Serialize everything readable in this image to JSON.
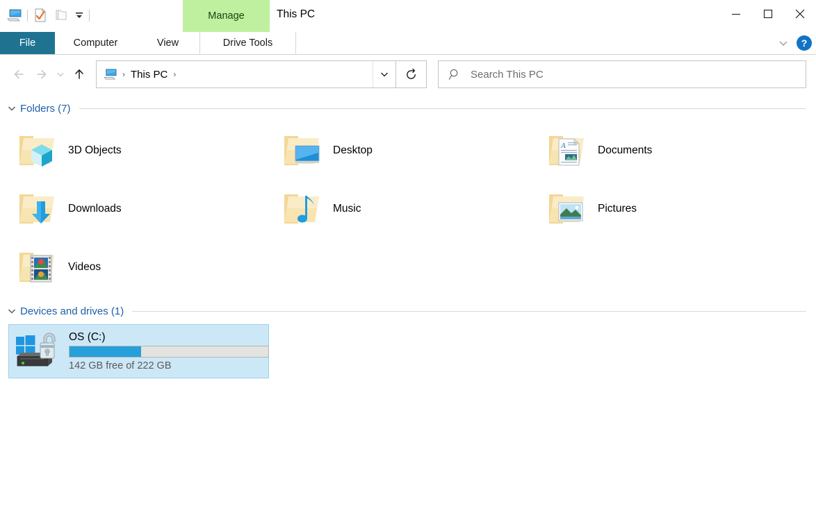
{
  "window": {
    "title": "This PC",
    "quick_access": [
      {
        "name": "this-pc-icon",
        "label": "This PC"
      },
      {
        "name": "properties-icon",
        "label": "Properties"
      },
      {
        "name": "new-folder-icon",
        "label": "New folder"
      },
      {
        "name": "customize-quick-access-icon",
        "label": "Customize Quick Access Toolbar"
      }
    ],
    "controls": {
      "minimize": "—",
      "maximize": "□",
      "close": "✕"
    }
  },
  "ribbon": {
    "contextual_group": "Manage",
    "tabs": [
      {
        "label": "File",
        "id": "file"
      },
      {
        "label": "Computer",
        "id": "computer"
      },
      {
        "label": "View",
        "id": "view"
      },
      {
        "label": "Drive Tools",
        "id": "drive-tools"
      }
    ],
    "collapse_icon": "chevron-down-icon",
    "help_label": "?"
  },
  "navigation": {
    "back_label": "Back",
    "forward_label": "Forward",
    "recent_label": "Recent locations",
    "up_label": "Up",
    "breadcrumb": {
      "icon": "this-pc-icon",
      "items": [
        "This PC"
      ],
      "separator": "›"
    },
    "address_dropdown": "chevron-down-icon",
    "refresh_label": "Refresh"
  },
  "search": {
    "placeholder": "Search This PC",
    "value": "",
    "icon": "search-icon"
  },
  "groups": [
    {
      "id": "folders",
      "title": "Folders (7)",
      "chevron": "chevron-down-icon",
      "items": [
        {
          "label": "3D Objects",
          "icon": "folder-3d-objects-icon"
        },
        {
          "label": "Desktop",
          "icon": "folder-desktop-icon"
        },
        {
          "label": "Documents",
          "icon": "folder-documents-icon"
        },
        {
          "label": "Downloads",
          "icon": "folder-downloads-icon"
        },
        {
          "label": "Music",
          "icon": "folder-music-icon"
        },
        {
          "label": "Pictures",
          "icon": "folder-pictures-icon"
        },
        {
          "label": "Videos",
          "icon": "folder-videos-icon"
        }
      ]
    },
    {
      "id": "devices",
      "title": "Devices and drives (1)",
      "chevron": "chevron-down-icon",
      "drives": [
        {
          "name": "OS (C:)",
          "capacity_text": "142 GB free of 222 GB",
          "free_gb": 142,
          "total_gb": 222,
          "used_percent": 36,
          "selected": true,
          "icon": "windows-drive-bitlocker-icon"
        }
      ]
    }
  ],
  "colors": {
    "file_tab": "#1f7391",
    "contextual_group": "#bff0a0",
    "group_title": "#1d5fa8",
    "selection": "#cce8f7",
    "selection_border": "#99d1f0",
    "drive_bar_fill": "#26a0da",
    "drive_bar_track": "#e3e3e1",
    "help_button": "#1273c4"
  }
}
